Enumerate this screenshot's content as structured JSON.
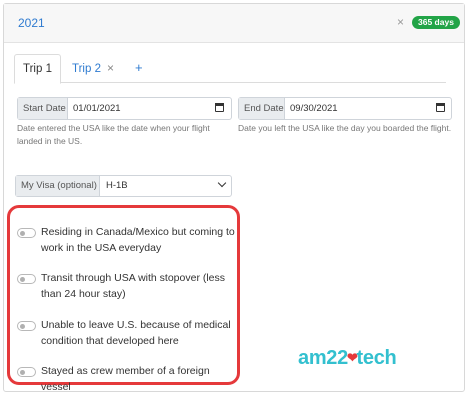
{
  "header": {
    "year": "2021",
    "close": "×",
    "days_badge": "365 days",
    "badge_color": "#22a447"
  },
  "tabs": [
    {
      "label": "Trip 1",
      "active": true
    },
    {
      "label": "Trip 2",
      "close": "×"
    },
    {
      "label": "+"
    }
  ],
  "start_date": {
    "label": "Start Date",
    "value": "01/01/2021",
    "help": "Date entered the USA like the date when your flight landed in the US."
  },
  "end_date": {
    "label": "End Date",
    "value": "09/30/2021",
    "help": "Date you left the USA like the day you boarded the flight."
  },
  "visa": {
    "label": "My Visa (optional)",
    "value": "H-1B"
  },
  "options": [
    {
      "label": "Residing in Canada/Mexico but coming to work in the USA everyday",
      "on": false
    },
    {
      "label": "Transit through USA with stopover (less than 24 hour stay)",
      "on": false
    },
    {
      "label": "Unable to leave U.S. because of medical condition that developed here",
      "on": false
    },
    {
      "label": "Stayed as crew member of a foreign vessel",
      "on": false
    }
  ],
  "watermark": {
    "left": "am22",
    "mark": "❤",
    "right": "tech"
  },
  "colors": {
    "accent": "#2f7bd0",
    "highlight": "#e5393b",
    "logo": "#33c0cf"
  }
}
